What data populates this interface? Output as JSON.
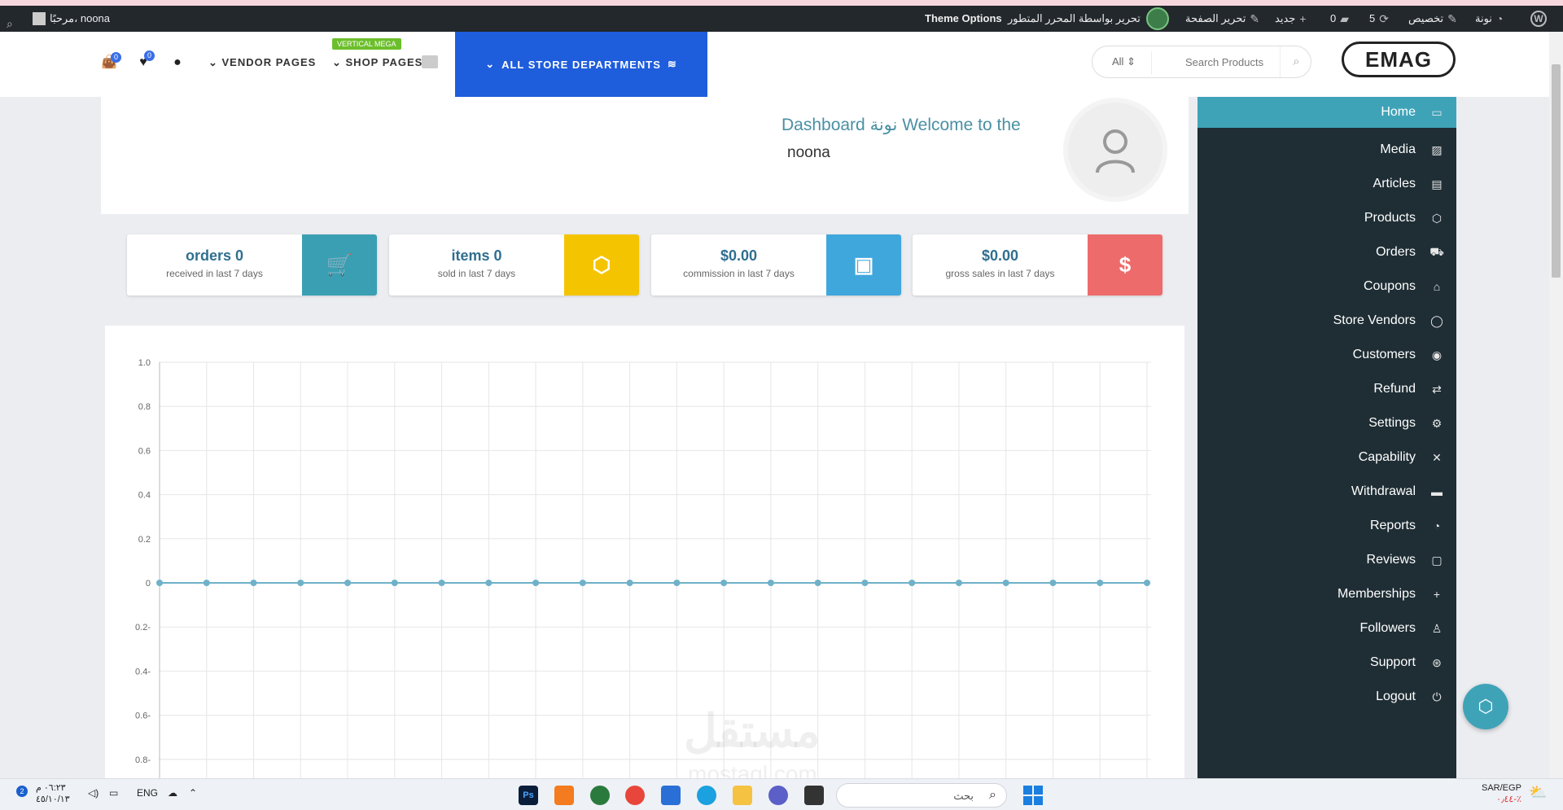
{
  "adminbar": {
    "site_name": "نونة",
    "customize": "تخصيص",
    "updates": "5",
    "comments": "0",
    "new": "جديد",
    "edit_page": "تحرير الصفحة",
    "edit_with": "تحرير بواسطة المحرر المتطور",
    "theme_options": "Theme Options",
    "howdy": "مرحبًا، noona"
  },
  "header": {
    "cart_count": "0",
    "wishlist_count": "0",
    "vendor_pages": "VENDOR PAGES",
    "shop_pages": "SHOP PAGES",
    "vertical_mega": "VERTICAL MEGA",
    "all_departments": "ALL STORE DEPARTMENTS",
    "search_category": "All",
    "search_placeholder": "Search Products",
    "logo": "EMAG"
  },
  "profile": {
    "welcome": "Dashboard نونة Welcome to the",
    "username": "noona"
  },
  "stats": [
    {
      "value": "orders 0",
      "sub": "received in last 7 days",
      "color": "#3a9fb2",
      "icon": "cart-icon"
    },
    {
      "value": "items 0",
      "sub": "sold in last 7 days",
      "color": "#f4c400",
      "icon": "box-icon"
    },
    {
      "value": "$0.00",
      "sub": "commission in last 7 days",
      "color": "#3fa7dc",
      "icon": "money-icon"
    },
    {
      "value": "$0.00",
      "sub": "gross sales in last 7 days",
      "color": "#ee6b6b",
      "icon": "dollar-icon"
    }
  ],
  "chart_data": {
    "type": "line",
    "y_ticks": [
      "1.0",
      "0.8",
      "0.6",
      "0.4",
      "0.2",
      "0",
      "0.2-",
      "0.4-",
      "0.6-",
      "0.8-"
    ],
    "ylim": [
      -0.8,
      1.0
    ],
    "grid": true,
    "series": [
      {
        "values": [
          0,
          0,
          0,
          0,
          0,
          0,
          0,
          0,
          0,
          0,
          0,
          0,
          0,
          0,
          0,
          0,
          0,
          0,
          0,
          0,
          0,
          0
        ],
        "color": "#6fb1c9"
      }
    ]
  },
  "sidebar": {
    "items": [
      {
        "label": "Home",
        "icon": "monitor-icon",
        "active": true
      },
      {
        "label": "Media",
        "icon": "image-icon"
      },
      {
        "label": "Articles",
        "icon": "document-icon"
      },
      {
        "label": "Products",
        "icon": "cube-icon"
      },
      {
        "label": "Orders",
        "icon": "cart-icon"
      },
      {
        "label": "Coupons",
        "icon": "gift-icon"
      },
      {
        "label": "Store Vendors",
        "icon": "user-icon"
      },
      {
        "label": "Customers",
        "icon": "user-circle-icon"
      },
      {
        "label": "Refund",
        "icon": "retweet-icon"
      },
      {
        "label": "Settings",
        "icon": "cogs-icon"
      },
      {
        "label": "Capability",
        "icon": "user-times-icon"
      },
      {
        "label": "Withdrawal",
        "icon": "credit-card-icon"
      },
      {
        "label": "Reports",
        "icon": "pie-chart-icon"
      },
      {
        "label": "Reviews",
        "icon": "comment-icon"
      },
      {
        "label": "Memberships",
        "icon": "user-plus-icon"
      },
      {
        "label": "Followers",
        "icon": "child-icon"
      },
      {
        "label": "Support",
        "icon": "lifebuoy-icon"
      },
      {
        "label": "Logout",
        "icon": "power-icon"
      }
    ]
  },
  "taskbar": {
    "time": "٠٦:٢٣ م",
    "date": "٤٥/١٠/١٣",
    "lang": "ENG",
    "search_placeholder": "بحث",
    "currency_pair": "SAR/EGP",
    "currency_change": "٠٫٤٤-٪"
  },
  "watermark": {
    "text": "مستقل",
    "domain": "mostaql.com"
  }
}
